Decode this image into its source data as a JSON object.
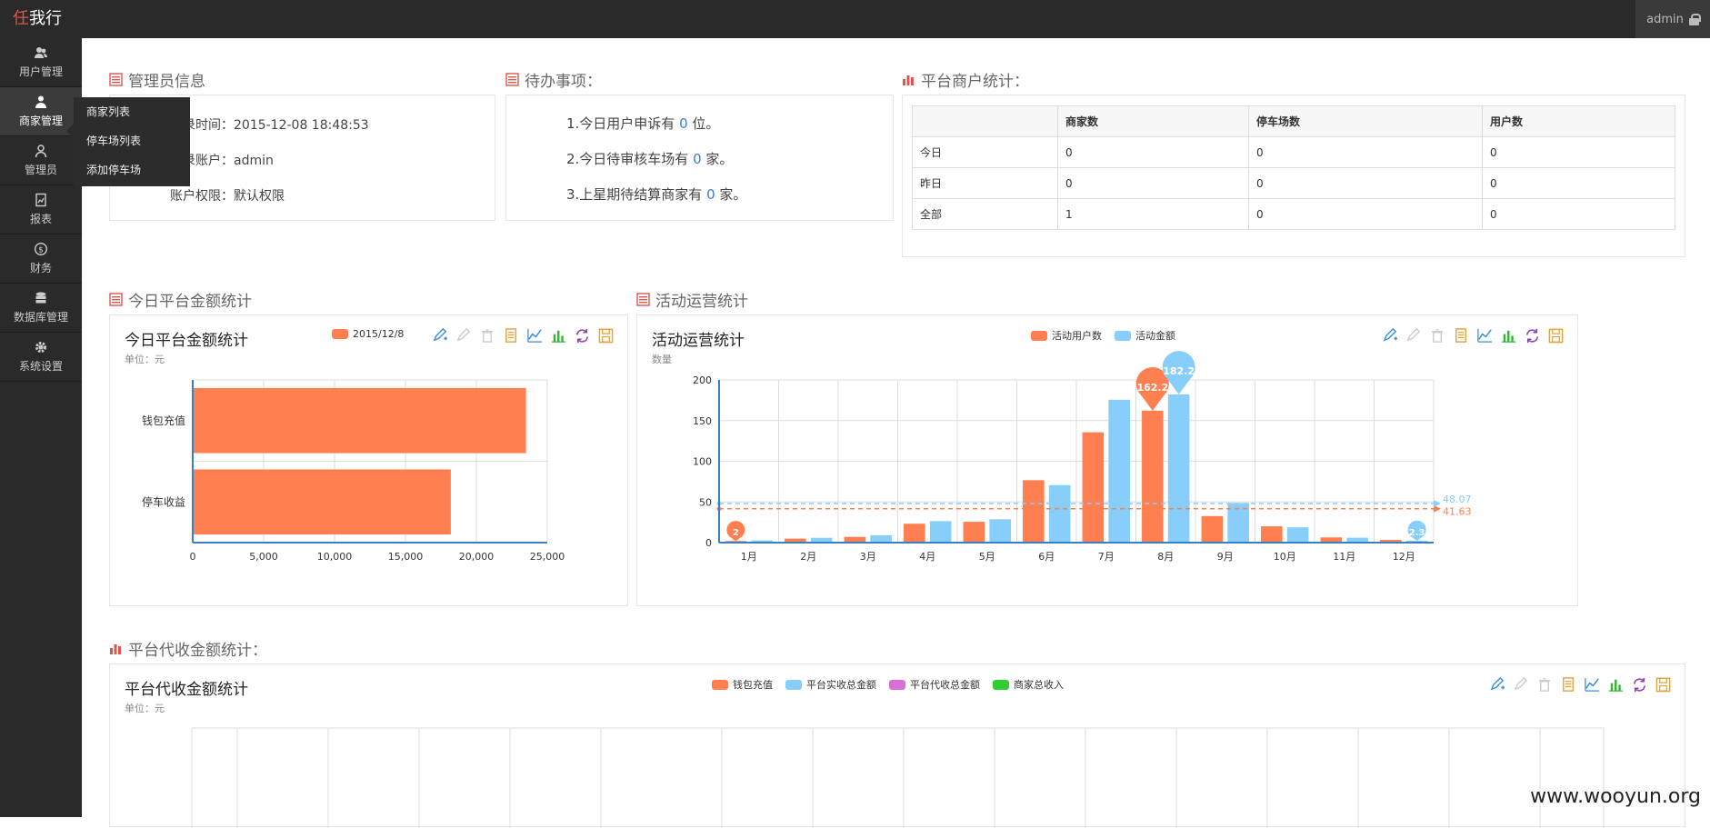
{
  "app": {
    "logo_first": "任",
    "logo_rest": "我行",
    "user": "admin"
  },
  "sidebar": {
    "items": [
      {
        "label": "用户管理",
        "icon": "users-icon"
      },
      {
        "label": "商家管理",
        "icon": "merchant-icon"
      },
      {
        "label": "管理员",
        "icon": "admin-user-icon"
      },
      {
        "label": "报表",
        "icon": "report-icon"
      },
      {
        "label": "财务",
        "icon": "finance-icon"
      },
      {
        "label": "数据库管理",
        "icon": "database-icon"
      },
      {
        "label": "系统设置",
        "icon": "gear-icon"
      }
    ],
    "flyout": [
      "商家列表",
      "停车场列表",
      "添加停车场"
    ]
  },
  "admin_info": {
    "title": "管理员信息",
    "login_time_label": "登录时间：",
    "login_time": "2015-12-08 18:48:53",
    "account_label": "登录账户：",
    "account": "admin",
    "perm_label": "账户权限：",
    "perm": "默认权限"
  },
  "todo": {
    "title": "待办事项：",
    "items": [
      {
        "pre": "1.今日用户申诉有 ",
        "num": "0",
        "post": " 位。"
      },
      {
        "pre": "2.今日待审核车场有 ",
        "num": "0",
        "post": " 家。"
      },
      {
        "pre": "3.上星期待结算商家有 ",
        "num": "0",
        "post": " 家。"
      }
    ]
  },
  "merchant_stats": {
    "title": "平台商户统计：",
    "headers": [
      "",
      "商家数",
      "停车场数",
      "用户数"
    ],
    "rows": [
      [
        "今日",
        "0",
        "0",
        "0"
      ],
      [
        "昨日",
        "0",
        "0",
        "0"
      ],
      [
        "全部",
        "1",
        "0",
        "0"
      ]
    ]
  },
  "today_amount": {
    "section_title": "今日平台金额统计",
    "title": "今日平台金额统计",
    "unit": "单位：元",
    "legend": "2015/12/8"
  },
  "activity": {
    "section_title": "活动运营统计",
    "title": "活动运营统计",
    "unit": "数量",
    "legend": [
      "活动用户数",
      "活动金额"
    ]
  },
  "collection": {
    "section_title": "平台代收金额统计：",
    "title": "平台代收金额统计",
    "unit": "单位：元",
    "legend": [
      "钱包充值",
      "平台实收总金额",
      "平台代收总金额",
      "商家总收入"
    ]
  },
  "colors": {
    "orange": "#ff7f50",
    "blue": "#87cefa",
    "purple": "#da70d6",
    "green": "#32cd32",
    "accent": "#e2554b"
  },
  "watermark": "www.wooyun.org",
  "chart_data": [
    {
      "type": "bar",
      "orientation": "horizontal",
      "title": "今日平台金额统计",
      "subtitle": "单位：元",
      "categories": [
        "钱包充值",
        "停车收益"
      ],
      "series": [
        {
          "name": "2015/12/8",
          "values": [
            23500,
            18200
          ]
        }
      ],
      "xlim": [
        0,
        25000
      ],
      "ticks": [
        "0",
        "5,000",
        "10,000",
        "15,000",
        "20,000",
        "25,000"
      ],
      "grid": true,
      "legend_position": "top"
    },
    {
      "type": "bar",
      "title": "活动运营统计",
      "subtitle": "数量",
      "categories": [
        "1月",
        "2月",
        "3月",
        "4月",
        "5月",
        "6月",
        "7月",
        "8月",
        "9月",
        "10月",
        "11月",
        "12月"
      ],
      "series": [
        {
          "name": "活动用户数",
          "values": [
            2,
            4.9,
            7,
            23.2,
            25.6,
            76.7,
            135.6,
            162.2,
            32.6,
            20,
            6.4,
            3.3
          ]
        },
        {
          "name": "活动金额",
          "values": [
            2.6,
            5.9,
            9,
            26.4,
            28.7,
            70.7,
            175.6,
            182.2,
            48.7,
            18.8,
            6,
            2.3
          ]
        }
      ],
      "ylim": [
        0,
        200
      ],
      "yticks": [
        "0",
        "50",
        "100",
        "150",
        "200"
      ],
      "mark_points": [
        {
          "series": "活动用户数",
          "label": "162.2",
          "category": "8月",
          "value": 162.2
        },
        {
          "series": "活动用户数",
          "label": "2",
          "category": "1月",
          "value": 2
        },
        {
          "series": "活动金额",
          "label": "182.2",
          "category": "8月",
          "value": 182.2
        },
        {
          "series": "活动金额",
          "label": "2.3",
          "category": "12月",
          "value": 2.3
        }
      ],
      "mark_lines": [
        {
          "series": "活动用户数",
          "label": "41.63",
          "value": 41.63
        },
        {
          "series": "活动金额",
          "label": "48.07",
          "value": 48.07
        }
      ],
      "grid": true,
      "legend_position": "top"
    },
    {
      "type": "line",
      "title": "平台代收金额统计",
      "subtitle": "单位：元",
      "series": [
        {
          "name": "钱包充值",
          "values": []
        },
        {
          "name": "平台实收总金额",
          "values": []
        },
        {
          "name": "平台代收总金额",
          "values": []
        },
        {
          "name": "商家总收入",
          "values": []
        }
      ],
      "grid": true,
      "legend_position": "top"
    }
  ]
}
